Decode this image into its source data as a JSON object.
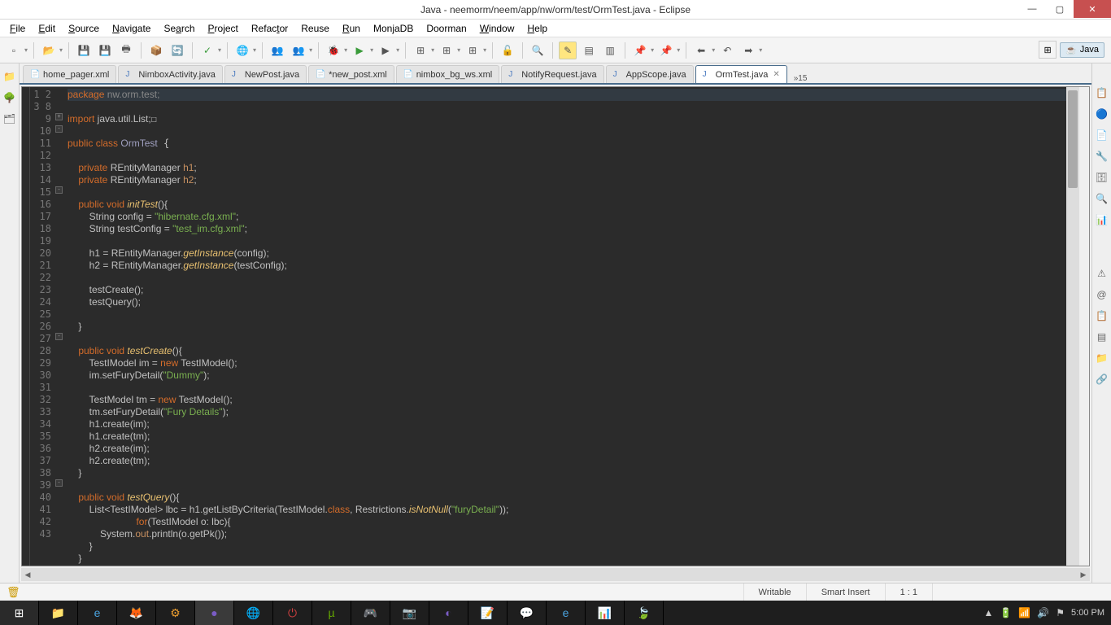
{
  "window": {
    "title": "Java - neemorm/neem/app/nw/orm/test/OrmTest.java - Eclipse"
  },
  "menu": [
    "File",
    "Edit",
    "Source",
    "Navigate",
    "Search",
    "Project",
    "Refactor",
    "Reuse",
    "Run",
    "MonjaDB",
    "Doorman",
    "Window",
    "Help"
  ],
  "perspective": {
    "label": "Java"
  },
  "tabs": [
    {
      "label": "home_pager.xml",
      "icon": "📄"
    },
    {
      "label": "NimboxActivity.java",
      "icon": "J"
    },
    {
      "label": "NewPost.java",
      "icon": "J"
    },
    {
      "label": "*new_post.xml",
      "icon": "📄"
    },
    {
      "label": "nimbox_bg_ws.xml",
      "icon": "📄"
    },
    {
      "label": "NotifyRequest.java",
      "icon": "J"
    },
    {
      "label": "AppScope.java",
      "icon": "J"
    },
    {
      "label": "OrmTest.java",
      "icon": "J",
      "active": true
    }
  ],
  "tabsmore": "»15",
  "code": {
    "lines": [
      1,
      2,
      3,
      8,
      9,
      10,
      11,
      12,
      13,
      14,
      15,
      16,
      17,
      18,
      19,
      20,
      21,
      22,
      23,
      24,
      25,
      26,
      27,
      28,
      29,
      30,
      31,
      32,
      33,
      34,
      35,
      36,
      37,
      38,
      39,
      40,
      41,
      42,
      43
    ],
    "l1_a": "package",
    "l1_b": " nw.orm.test;",
    "l3_a": "import",
    "l3_b": " java.util.List;",
    "l9_a": "public class ",
    "l9_b": "OrmTest",
    " l9_c": " {",
    "l11_a": "    private ",
    "l11_b": "REntityManager ",
    "l11_c": "h1",
    "l11_d": ";",
    "l12_a": "    private ",
    "l12_b": "REntityManager ",
    "l12_c": "h2",
    "l12_d": ";",
    "l14_a": "    public void ",
    "l14_b": "initTest",
    "l14_c": "(){",
    "l15_a": "        String config = ",
    "l15_b": "\"hibernate.cfg.xml\"",
    "l15_c": ";",
    "l16_a": "        String testConfig = ",
    "l16_b": "\"test_im.cfg.xml\"",
    "l16_c": ";",
    "l18": "        h1 = REntityManager.",
    "l18_b": "getInstance",
    "l18_c": "(config);",
    "l19": "        h2 = REntityManager.",
    "l19_b": "getInstance",
    "l19_c": "(testConfig);",
    "l21": "        testCreate();",
    "l22": "        testQuery();",
    "l24": "    }",
    "l26_a": "    public void ",
    "l26_b": "testCreate",
    "l26_c": "(){",
    "l27_a": "        TestIModel im = ",
    "l27_b": "new",
    "l27_c": " TestIModel();",
    "l28_a": "        im.setFuryDetail(",
    "l28_b": "\"Dummy\"",
    "l28_c": ");",
    "l30_a": "        TestModel tm = ",
    "l30_b": "new",
    "l30_c": " TestModel();",
    "l31_a": "        tm.setFuryDetail(",
    "l31_b": "\"Fury Details\"",
    "l31_c": ");",
    "l32": "        h1.create(im);",
    "l33": "        h1.create(tm);",
    "l34": "        h2.create(im);",
    "l35": "        h2.create(tm);",
    "l36": "    }",
    "l38_a": "    public void ",
    "l38_b": "testQuery",
    "l38_c": "(){",
    "l39_a": "        List<TestIModel> lbc = h1.getListByCriteria(TestIModel.",
    "l39_b": "class",
    "l39_c": ", Restrictions.",
    "l39_d": "isNotNull",
    "l39_e": "(",
    "l39_f": "\"furyDetail\"",
    "l39_g": "));",
    "l40_a": "        for",
    "l40_b": "(TestIModel o: lbc){",
    "l41_a": "            System.",
    "l41_b": "out",
    "l41_c": ".println(o.getPk());",
    "l42": "        }",
    "l43": "    }"
  },
  "status": {
    "writable": "Writable",
    "insert": "Smart Insert",
    "pos": "1 : 1"
  },
  "clock": "5:00 PM"
}
